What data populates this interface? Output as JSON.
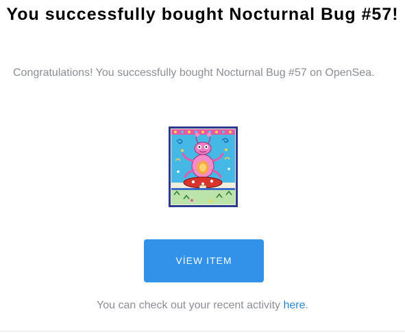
{
  "email": {
    "title": "You successfully bought Nocturnal Bug #57!",
    "intro": "Congratulations! You successfully bought Nocturnal Bug #57 on OpenSea.",
    "image": {
      "icon": "nft-artwork-image"
    },
    "button": {
      "label": "VİEW ITEM",
      "color": "#3291e9"
    },
    "footer": {
      "prefix": "You can check out your recent activity ",
      "link": "here",
      "suffix": "."
    },
    "colors": {
      "text_muted": "#8a8f96",
      "link": "#2a86d9"
    }
  }
}
